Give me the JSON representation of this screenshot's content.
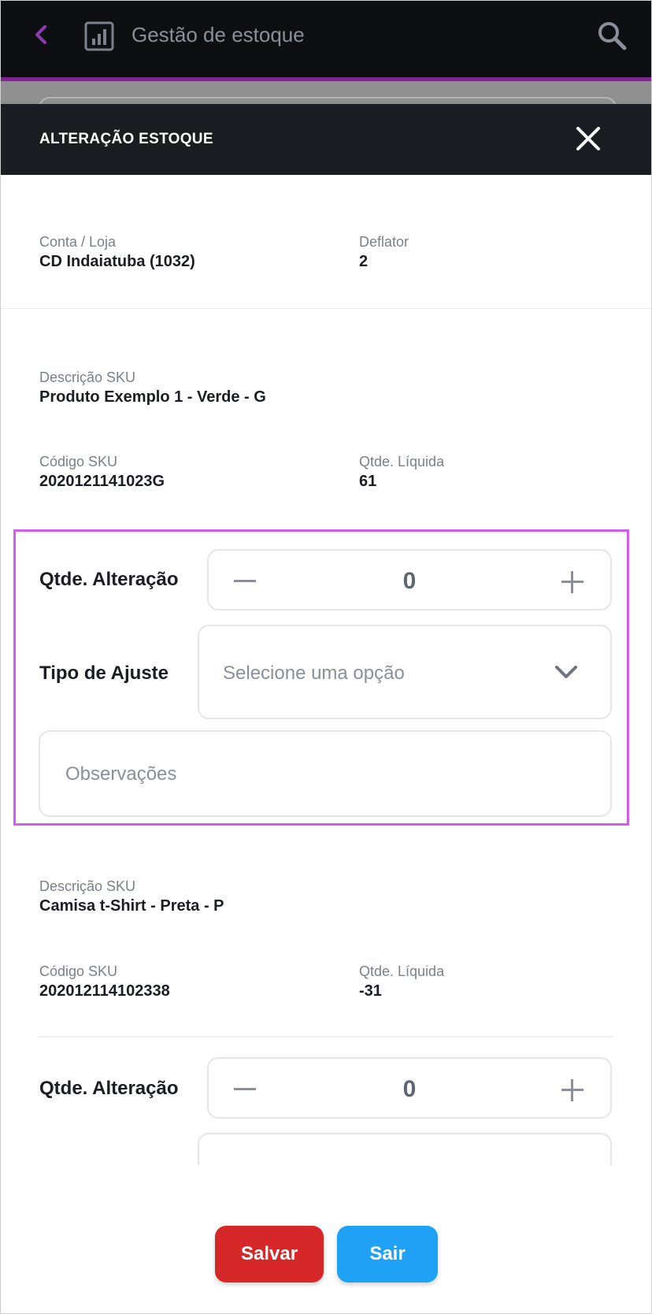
{
  "app_bar": {
    "title": "Gestão de estoque"
  },
  "modal": {
    "title": "ALTERAÇÃO ESTOQUE"
  },
  "store": {
    "account_label": "Conta / Loja",
    "account_value": "CD Indaiatuba (1032)",
    "deflator_label": "Deflator",
    "deflator_value": "2"
  },
  "items": [
    {
      "desc_label": "Descrição SKU",
      "desc_value": "Produto Exemplo 1 - Verde - G",
      "code_label": "Código SKU",
      "code_value": "2020121141023G",
      "qty_label": "Qtde. Líquida",
      "qty_value": "61",
      "change_label": "Qtde. Alteração",
      "change_value": "0",
      "adjust_label": "Tipo de Ajuste",
      "adjust_placeholder": "Selecione uma opção",
      "notes_placeholder": "Observações"
    },
    {
      "desc_label": "Descrição SKU",
      "desc_value": "Camisa t-Shirt - Preta - P",
      "code_label": "Código SKU",
      "code_value": "202012114102338",
      "qty_label": "Qtde. Líquida",
      "qty_value": "-31",
      "change_label": "Qtde. Alteração",
      "change_value": "0"
    }
  ],
  "actions": {
    "save_label": "Salvar",
    "exit_label": "Sair"
  },
  "colors": {
    "accent": "#7b2a8c",
    "highlight": "#d35bf0",
    "save": "#d62828",
    "exit": "#1fa2f5"
  }
}
